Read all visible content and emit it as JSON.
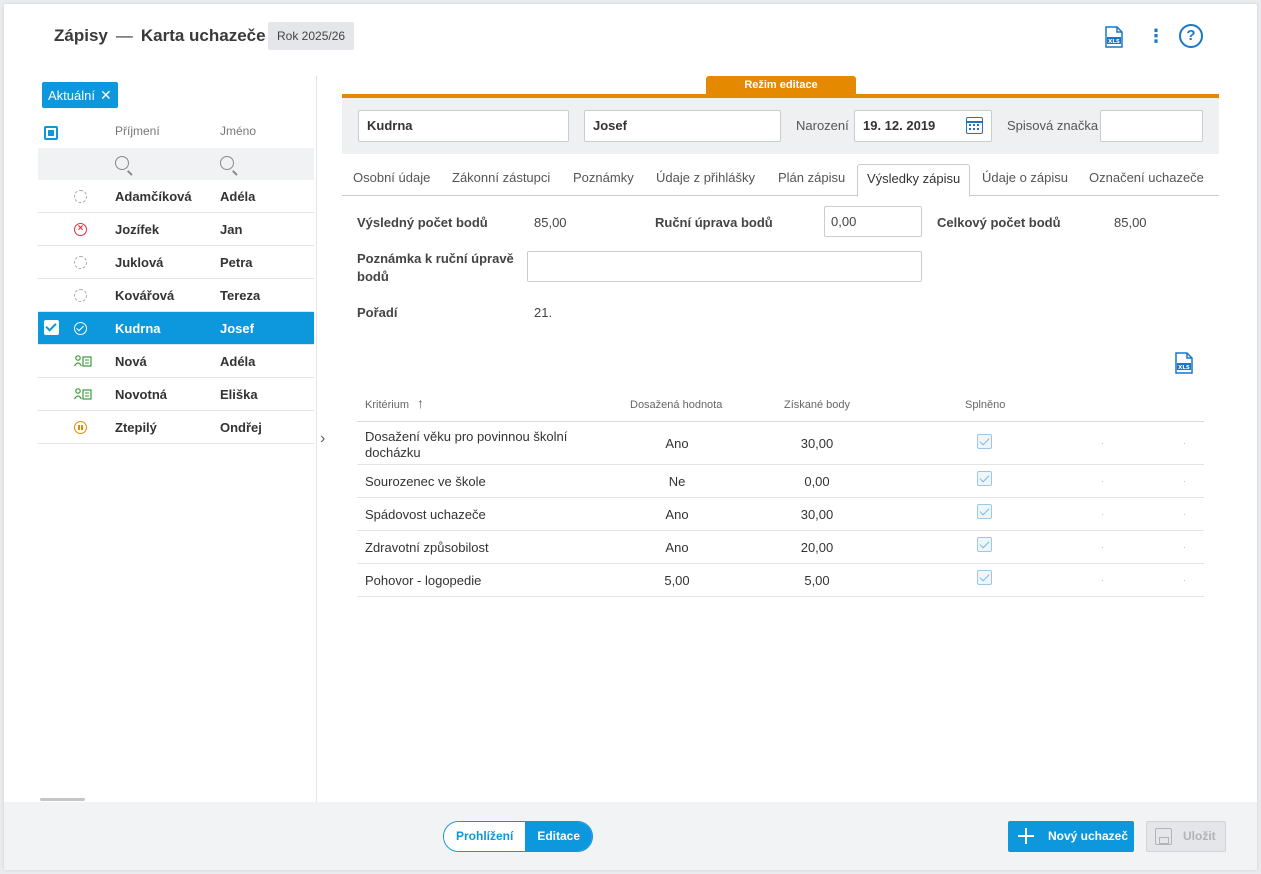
{
  "header": {
    "section": "Zápisy",
    "separator": "—",
    "page": "Karta uchazeče",
    "year": "Rok 2025/26",
    "icons": [
      "xls-export-icon",
      "more-vertical-icon",
      "help-icon"
    ]
  },
  "left": {
    "filter_chip": "Aktuální",
    "col_surname": "Příjmení",
    "col_name": "Jméno",
    "rows": [
      {
        "surname": "Adamčíková",
        "name": "Adéla",
        "status": "pending"
      },
      {
        "surname": "Jozífek",
        "name": "Jan",
        "status": "rejected"
      },
      {
        "surname": "Juklová",
        "name": "Petra",
        "status": "pending"
      },
      {
        "surname": "Kovářová",
        "name": "Tereza",
        "status": "pending"
      },
      {
        "surname": "Kudrna",
        "name": "Josef",
        "status": "accepted",
        "selected": true
      },
      {
        "surname": "Nová",
        "name": "Adéla",
        "status": "user"
      },
      {
        "surname": "Novotná",
        "name": "Eliška",
        "status": "user"
      },
      {
        "surname": "Ztepilý",
        "name": "Ondřej",
        "status": "paused"
      }
    ]
  },
  "mode_label": "Režim editace",
  "idbar": {
    "surname": "Kudrna",
    "name": "Josef",
    "birth_label": "Narození",
    "birth": "19. 12. 2019",
    "file_label": "Spisová značka",
    "file_value": ""
  },
  "tabs": [
    "Osobní údaje",
    "Zákonní zástupci",
    "Poznámky",
    "Údaje z přihlášky",
    "Plán zápisu",
    "Výsledky zápisu",
    "Údaje o zápisu",
    "Označení uchazeče"
  ],
  "active_tab": "Výsledky zápisu",
  "results": {
    "points_label": "Výsledný počet bodů",
    "points": "85,00",
    "manual_label": "Ruční úprava bodů",
    "manual": "0,00",
    "total_label": "Celkový počet bodů",
    "total": "85,00",
    "note_label_1": "Poznámka k ruční úpravě",
    "note_label_2": "bodů",
    "note": "",
    "rank_label": "Pořadí",
    "rank": "21."
  },
  "grid": {
    "headers": {
      "criterion": "Kritérium",
      "sort_icon": "↑",
      "value": "Dosažená hodnota",
      "points": "Získané body",
      "met": "Splněno"
    },
    "rows": [
      {
        "criterion_1": "Dosažení věku pro povinnou školní",
        "criterion_2": "docházku",
        "value": "Ano",
        "points": "30,00",
        "met": true
      },
      {
        "criterion_1": "Sourozenec ve škole",
        "criterion_2": "",
        "value": "Ne",
        "points": "0,00",
        "met": true
      },
      {
        "criterion_1": "Spádovost uchazeče",
        "criterion_2": "",
        "value": "Ano",
        "points": "30,00",
        "met": true
      },
      {
        "criterion_1": "Zdravotní způsobilost",
        "criterion_2": "",
        "value": "Ano",
        "points": "20,00",
        "met": true
      },
      {
        "criterion_1": "Pohovor - logopedie",
        "criterion_2": "",
        "value": "5,00",
        "points": "5,00",
        "met": true
      }
    ],
    "dot": "·"
  },
  "footer": {
    "view": "Prohlížení",
    "edit": "Editace",
    "new_button": "Nový uchazeč",
    "save_button": "Uložit"
  },
  "colors": {
    "accent": "#0d97dc",
    "edit_mode": "#e58a00",
    "reject": "#d9343b"
  }
}
